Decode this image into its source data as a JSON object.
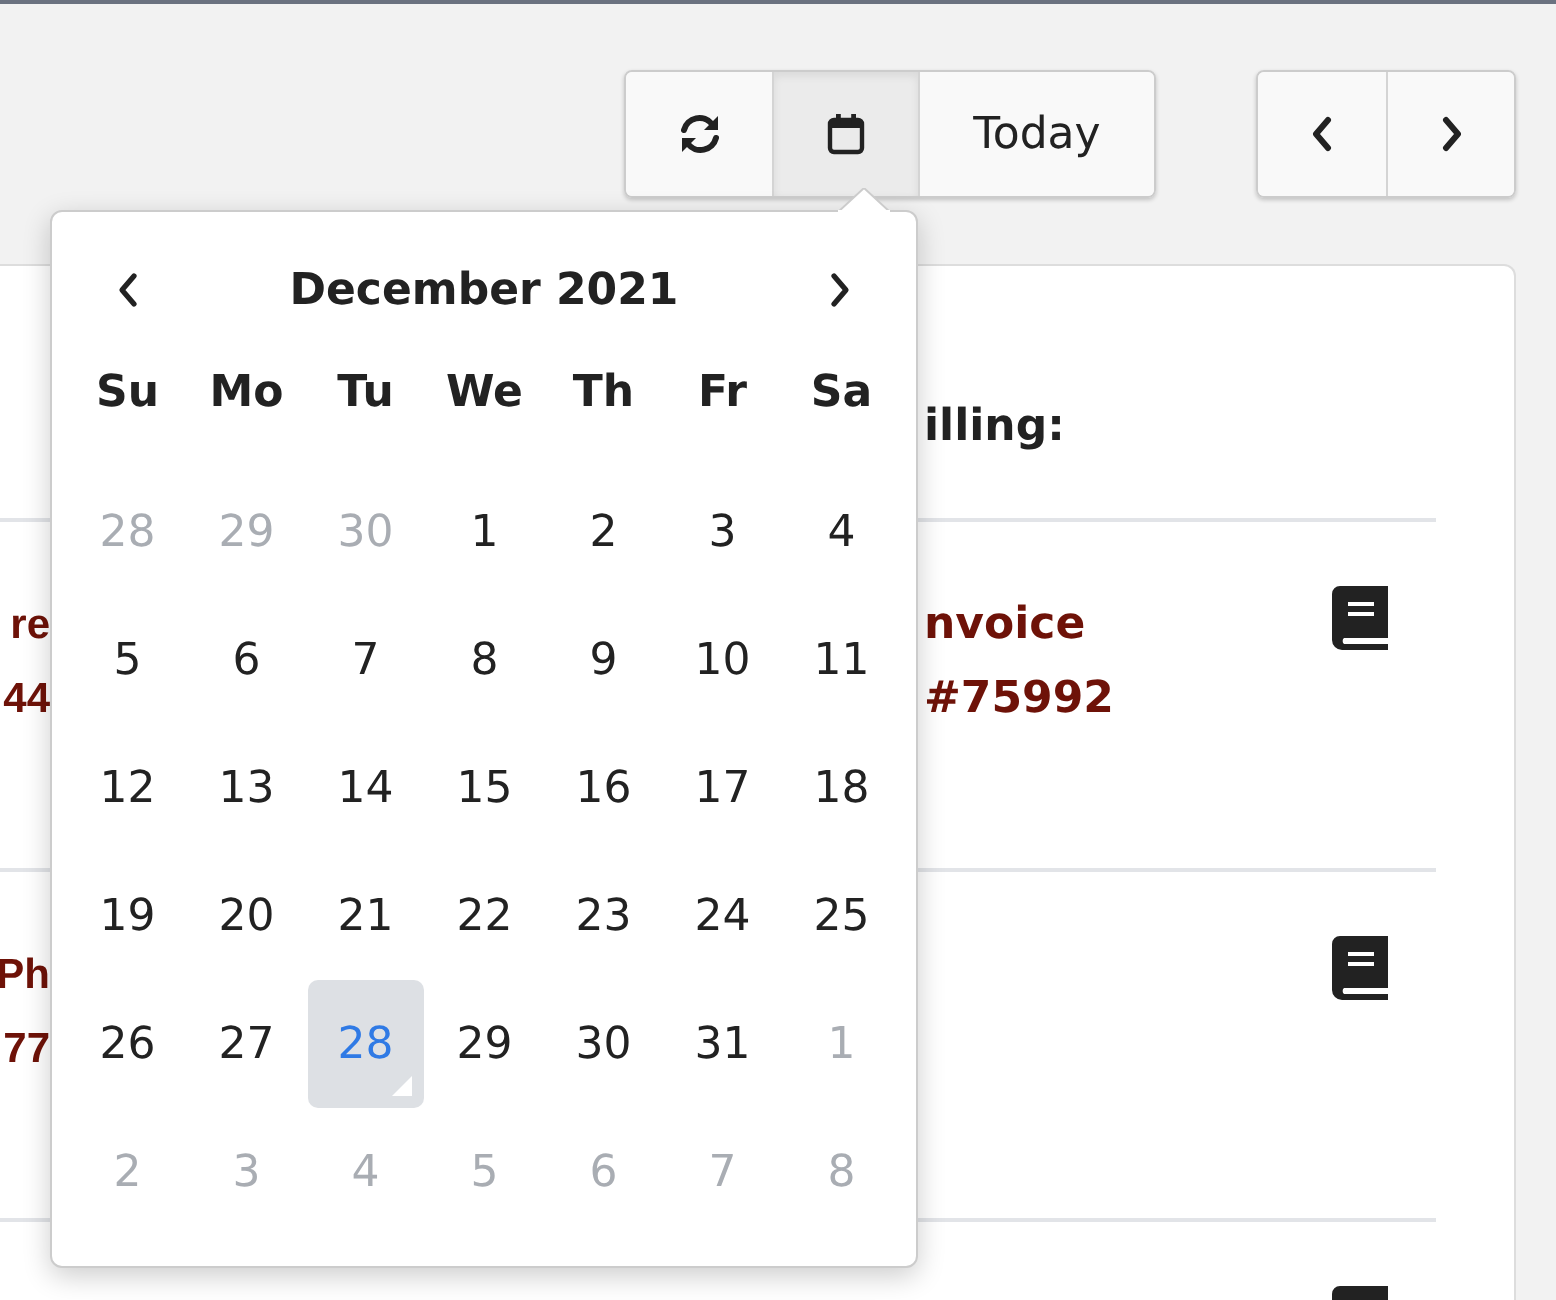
{
  "view_buttons": [
    {
      "kind": "refresh",
      "selected": false
    },
    {
      "kind": "calendar",
      "selected": true
    },
    {
      "kind": "today",
      "label": "Today",
      "selected": false
    }
  ],
  "nav_buttons": [
    {
      "kind": "prev"
    },
    {
      "kind": "next"
    }
  ],
  "card": {
    "column_heading": "illing:",
    "rows": [
      {
        "kind": "entry",
        "left_lines": [
          "re",
          "44"
        ],
        "right_lines": [
          "nvoice",
          "#75992"
        ]
      },
      {
        "kind": "entry",
        "left_lines": [
          "Ph",
          "77"
        ]
      },
      {
        "kind": "entry"
      }
    ]
  },
  "datepicker": {
    "title": "December 2021",
    "weekdays": [
      "Su",
      "Mo",
      "Tu",
      "We",
      "Th",
      "Fr",
      "Sa"
    ],
    "weeks": [
      [
        {
          "day": "28",
          "outside_month": true,
          "selected": false
        },
        {
          "day": "29",
          "outside_month": true,
          "selected": false
        },
        {
          "day": "30",
          "outside_month": true,
          "selected": false
        },
        {
          "day": "1",
          "outside_month": false,
          "selected": false
        },
        {
          "day": "2",
          "outside_month": false,
          "selected": false
        },
        {
          "day": "3",
          "outside_month": false,
          "selected": false
        },
        {
          "day": "4",
          "outside_month": false,
          "selected": false
        }
      ],
      [
        {
          "day": "5",
          "outside_month": false,
          "selected": false
        },
        {
          "day": "6",
          "outside_month": false,
          "selected": false
        },
        {
          "day": "7",
          "outside_month": false,
          "selected": false
        },
        {
          "day": "8",
          "outside_month": false,
          "selected": false
        },
        {
          "day": "9",
          "outside_month": false,
          "selected": false
        },
        {
          "day": "10",
          "outside_month": false,
          "selected": false
        },
        {
          "day": "11",
          "outside_month": false,
          "selected": false
        }
      ],
      [
        {
          "day": "12",
          "outside_month": false,
          "selected": false
        },
        {
          "day": "13",
          "outside_month": false,
          "selected": false
        },
        {
          "day": "14",
          "outside_month": false,
          "selected": false
        },
        {
          "day": "15",
          "outside_month": false,
          "selected": false
        },
        {
          "day": "16",
          "outside_month": false,
          "selected": false
        },
        {
          "day": "17",
          "outside_month": false,
          "selected": false
        },
        {
          "day": "18",
          "outside_month": false,
          "selected": false
        }
      ],
      [
        {
          "day": "19",
          "outside_month": false,
          "selected": false
        },
        {
          "day": "20",
          "outside_month": false,
          "selected": false
        },
        {
          "day": "21",
          "outside_month": false,
          "selected": false
        },
        {
          "day": "22",
          "outside_month": false,
          "selected": false
        },
        {
          "day": "23",
          "outside_month": false,
          "selected": false
        },
        {
          "day": "24",
          "outside_month": false,
          "selected": false
        },
        {
          "day": "25",
          "outside_month": false,
          "selected": false
        }
      ],
      [
        {
          "day": "26",
          "outside_month": false,
          "selected": false
        },
        {
          "day": "27",
          "outside_month": false,
          "selected": false
        },
        {
          "day": "28",
          "outside_month": false,
          "selected": true
        },
        {
          "day": "29",
          "outside_month": false,
          "selected": false
        },
        {
          "day": "30",
          "outside_month": false,
          "selected": false
        },
        {
          "day": "31",
          "outside_month": false,
          "selected": false
        },
        {
          "day": "1",
          "outside_month": true,
          "selected": false
        }
      ],
      [
        {
          "day": "2",
          "outside_month": true,
          "selected": false
        },
        {
          "day": "3",
          "outside_month": true,
          "selected": false
        },
        {
          "day": "4",
          "outside_month": true,
          "selected": false
        },
        {
          "day": "5",
          "outside_month": true,
          "selected": false
        },
        {
          "day": "6",
          "outside_month": true,
          "selected": false
        },
        {
          "day": "7",
          "outside_month": true,
          "selected": false
        },
        {
          "day": "8",
          "outside_month": true,
          "selected": false
        }
      ]
    ]
  }
}
